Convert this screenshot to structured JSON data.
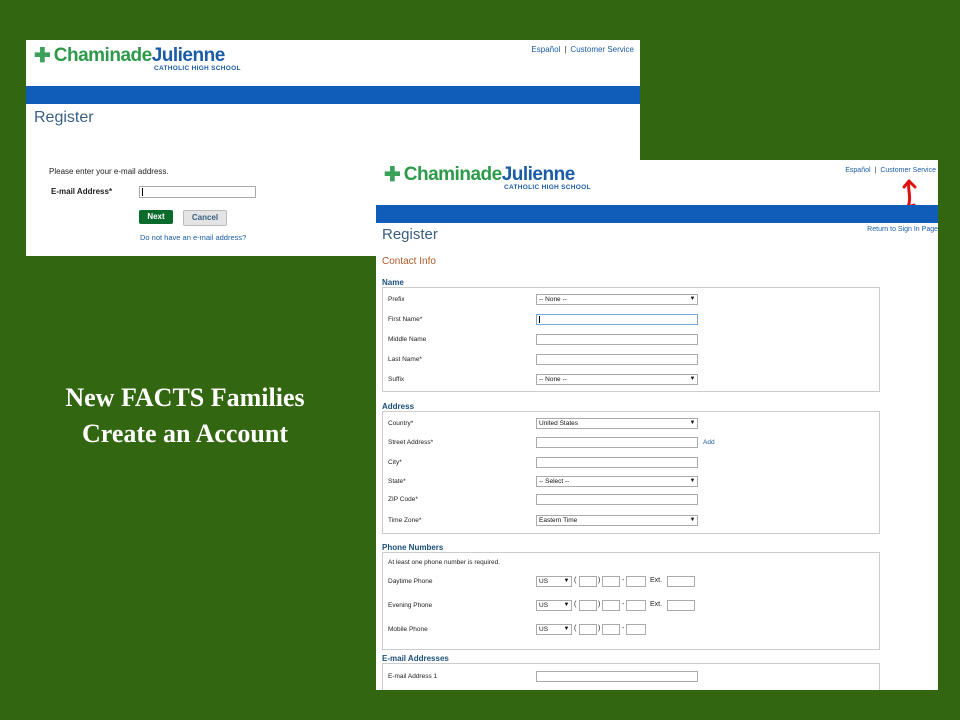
{
  "school": {
    "name_part1": "Chaminade",
    "name_part2": "Julienne",
    "tagline": "CATHOLIC HIGH SCHOOL"
  },
  "top_links": {
    "espanol": "Español",
    "separator": "|",
    "customer_service": "Customer Service"
  },
  "screen1": {
    "title": "Register",
    "instruction": "Please enter your e-mail address.",
    "email_label": "E-mail Address*",
    "email_value": "",
    "next_label": "Next",
    "cancel_label": "Cancel",
    "no_email_link": "Do not have an e-mail address?"
  },
  "screen2": {
    "title": "Register",
    "return_link": "Return to Sign In Page",
    "subtitle": "Contact Info",
    "name_section": {
      "heading": "Name",
      "prefix_label": "Prefix",
      "prefix_value": "-- None --",
      "first_label": "First Name*",
      "middle_label": "Middle Name",
      "last_label": "Last Name*",
      "suffix_label": "Suffix",
      "suffix_value": "-- None --"
    },
    "address_section": {
      "heading": "Address",
      "country_label": "Country*",
      "country_value": "United States",
      "street_label": "Street Address*",
      "add_link": "Add",
      "city_label": "City*",
      "state_label": "State*",
      "state_value": "-- Select --",
      "zip_label": "ZIP Code*",
      "timezone_label": "Time Zone*",
      "timezone_value": "Eastern Time"
    },
    "phone_section": {
      "heading": "Phone Numbers",
      "note": "At least one phone number is required.",
      "rows": [
        {
          "label": "Daytime Phone",
          "country": "US",
          "ext_label": "Ext."
        },
        {
          "label": "Evening Phone",
          "country": "US",
          "ext_label": "Ext."
        },
        {
          "label": "Mobile Phone",
          "country": "US",
          "ext_label": ""
        }
      ],
      "open_paren": "(",
      "close_paren": ")",
      "dash": "-"
    },
    "email_section": {
      "heading": "E-mail Addresses",
      "email1_label": "E-mail Address 1"
    }
  },
  "caption": {
    "line1": "New FACTS Families",
    "line2": "Create an Account"
  },
  "colors": {
    "background": "#336610",
    "blue_bar": "#0f5db8",
    "next_button": "#0b6b2c",
    "annotation_arrow": "#e01010"
  },
  "icons": [
    "dropdown-arrow-icon",
    "red-arrow-annotation-icon",
    "logo-cross-icon"
  ]
}
